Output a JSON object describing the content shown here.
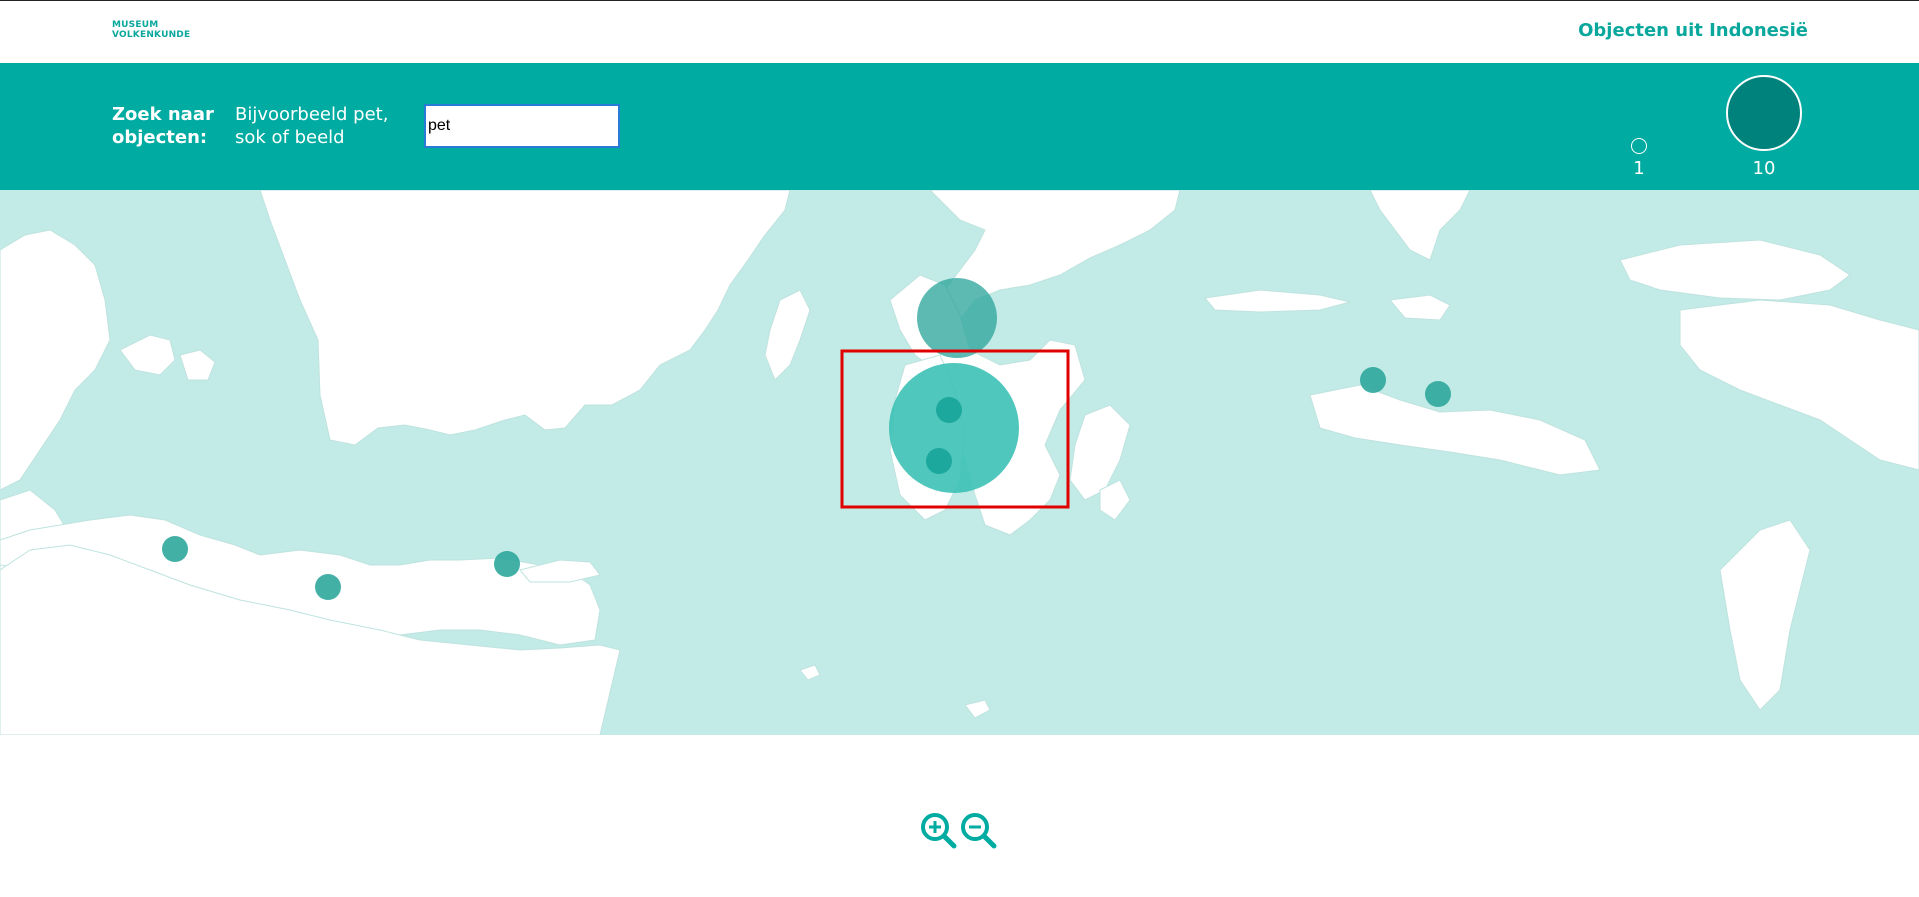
{
  "header": {
    "logo": {
      "line1": "MUSEUM",
      "line2": "VOLKENKUNDE"
    },
    "title": "Objecten uit Indonesië"
  },
  "search": {
    "label": "Zoek naar objecten:",
    "hint": "Bijvoorbeeld pet, sok of beeld",
    "value": "pet",
    "placeholder": ""
  },
  "legend": {
    "small_value": "1",
    "large_value": "10"
  },
  "map": {
    "land_color": "#ffffff",
    "sea_color": "#c2eae6",
    "marker_color": "#2fa79c",
    "highlight_color": "#e00000",
    "selected_marker_color": "#3cc1b5"
  },
  "zoom": {
    "in_icon": "zoom-in-icon",
    "out_icon": "zoom-out-icon"
  },
  "colors": {
    "accent": "#00aba1",
    "brand_text": "#0aa79d"
  }
}
